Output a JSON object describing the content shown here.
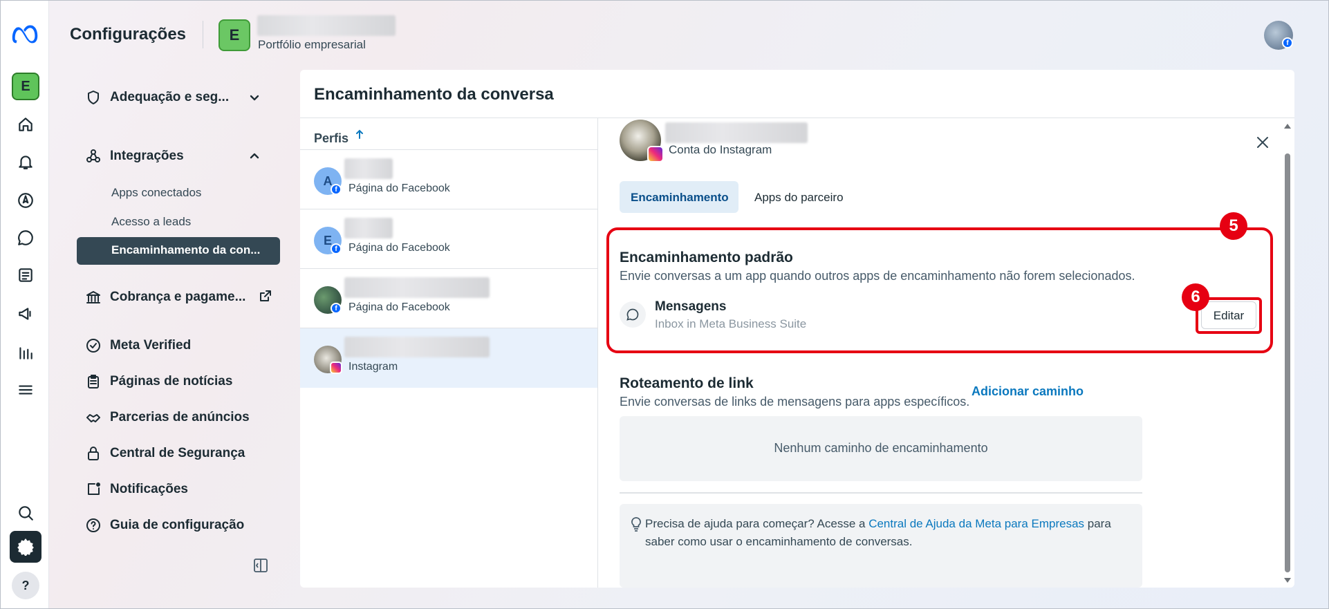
{
  "header": {
    "title": "Configurações",
    "business_initial": "E",
    "business_type": "Portfólio empresarial"
  },
  "rail": {
    "avatar_initial": "E",
    "help_label": "?"
  },
  "nav": {
    "adequacao": "Adequação e seg...",
    "integracoes": "Integrações",
    "sub_apps": "Apps conectados",
    "sub_leads": "Acesso a leads",
    "sub_encaminhamento": "Encaminhamento da con...",
    "cobranca": "Cobrança e pagame...",
    "meta_verified": "Meta Verified",
    "paginas_noticias": "Páginas de notícias",
    "parcerias": "Parcerias de anúncios",
    "central_seguranca": "Central de Segurança",
    "notificacoes": "Notificações",
    "guia": "Guia de configuração"
  },
  "main": {
    "title": "Encaminhamento da conversa",
    "list_header": "Perfis",
    "profiles": [
      {
        "initial": "A",
        "type": "Página do Facebook"
      },
      {
        "initial": "E",
        "type": "Página do Facebook"
      },
      {
        "initial": "",
        "type": "Página do Facebook"
      },
      {
        "initial": "",
        "type": "Instagram"
      }
    ]
  },
  "detail": {
    "account_type": "Conta do Instagram",
    "tabs": [
      "Encaminhamento",
      "Apps do parceiro"
    ],
    "default_routing": {
      "title": "Encaminhamento padrão",
      "description": "Envie conversas a um app quando outros apps de encaminhamento não forem selecionados.",
      "app_name": "Mensagens",
      "app_sub": "Inbox in Meta Business Suite",
      "edit_label": "Editar"
    },
    "link_routing": {
      "title": "Roteamento de link",
      "description": "Envie conversas de links de mensagens para apps específicos.",
      "add_label": "Adicionar caminho",
      "empty": "Nenhum caminho de encaminhamento"
    },
    "help": {
      "before": "Precisa de ajuda para começar? Acesse a ",
      "link": "Central de Ajuda da Meta para Empresas",
      "after": " para saber como usar o encaminhamento de conversas."
    }
  },
  "annotations": {
    "step5": "5",
    "step6": "6"
  },
  "colors": {
    "accent": "#0a78be",
    "annotation": "#e60012",
    "active_nav": "#344854"
  }
}
